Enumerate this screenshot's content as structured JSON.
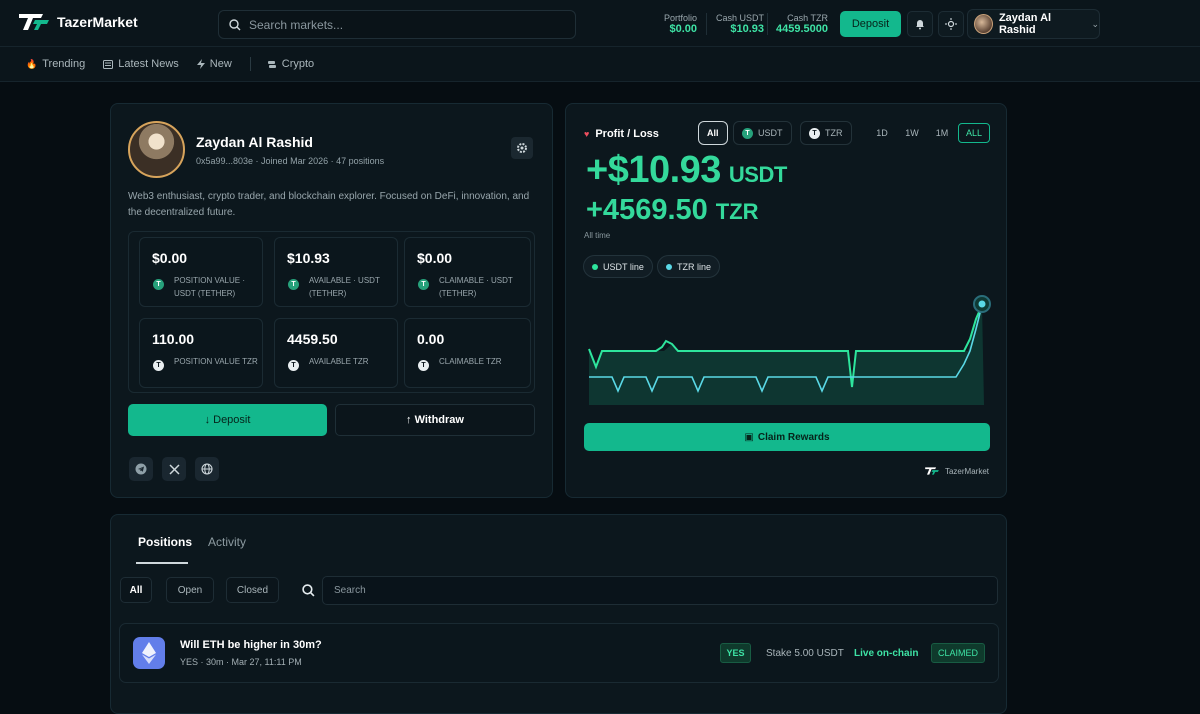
{
  "brand": {
    "name": "TazerMarket"
  },
  "search": {
    "placeholder": "Search markets..."
  },
  "header_stats": [
    {
      "label": "Portfolio",
      "value": "$0.00"
    },
    {
      "label": "Cash USDT",
      "value": "$10.93"
    },
    {
      "label": "Cash TZR",
      "value": "4459.5000"
    }
  ],
  "header": {
    "deposit_label": "Deposit",
    "user_name": "Zaydan Al Rashid",
    "user_chevron": "⌄"
  },
  "nav": {
    "items": [
      {
        "icon": "flame-icon",
        "label": "Trending"
      },
      {
        "icon": "newspaper-icon",
        "label": "Latest News"
      },
      {
        "icon": "bolt-icon",
        "label": "New"
      },
      {
        "icon": "coins-icon",
        "label": "Crypto"
      }
    ]
  },
  "profile": {
    "name": "Zaydan Al Rashid",
    "meta": "0x5a99...803e · Joined Mar 2026 · 47 positions",
    "bio": "Web3 enthusiast, crypto trader, and blockchain explorer. Focused on DeFi, innovation, and the decentralized future.",
    "stats": [
      {
        "value": "$0.00",
        "label": "POSITION VALUE · USDT (TETHER)",
        "token": "usdt"
      },
      {
        "value": "$10.93",
        "label": "AVAILABLE · USDT (TETHER)",
        "token": "usdt"
      },
      {
        "value": "$0.00",
        "label": "CLAIMABLE · USDT (TETHER)",
        "token": "usdt"
      },
      {
        "value": "110.00",
        "label": "POSITION VALUE TZR",
        "token": "tzr"
      },
      {
        "value": "4459.50",
        "label": "AVAILABLE TZR",
        "token": "tzr"
      },
      {
        "value": "0.00",
        "label": "CLAIMABLE TZR",
        "token": "tzr"
      }
    ],
    "deposit_label": "↓ Deposit",
    "withdraw_label": "↑ Withdraw",
    "socials": [
      "telegram-icon",
      "x-icon",
      "globe-icon"
    ]
  },
  "pnl": {
    "title": "Profit / Loss",
    "currency_tabs": [
      "All",
      "USDT",
      "TZR"
    ],
    "active_currency": "All",
    "timeframes": [
      "1D",
      "1W",
      "1M",
      "ALL"
    ],
    "active_timeframe": "ALL",
    "usdt_value": "+$10.93",
    "usdt_unit": "USDT",
    "tzr_value": "+4569.50",
    "tzr_unit": "TZR",
    "period": "All time",
    "legend": [
      {
        "label": "USDT line",
        "color": "#2ee59d"
      },
      {
        "label": "TZR line",
        "color": "#5ad8e6"
      }
    ],
    "claim_label": "Claim Rewards",
    "watermark": "TazerMarket"
  },
  "positions": {
    "tabs": [
      "Positions",
      "Activity"
    ],
    "filters": [
      "All",
      "Open",
      "Closed"
    ],
    "search_placeholder": "Search",
    "rows": [
      {
        "question": "Will ETH be higher in 30m?",
        "meta": "YES · 30m · Mar 27, 11:11 PM",
        "side": "YES",
        "stake": "Stake 5.00 USDT",
        "status": "Live on-chain",
        "state": "CLAIMED"
      }
    ]
  },
  "colors": {
    "accent": "#13b88d",
    "positive": "#34d99b",
    "background": "#060d12",
    "card": "#0c171d"
  }
}
